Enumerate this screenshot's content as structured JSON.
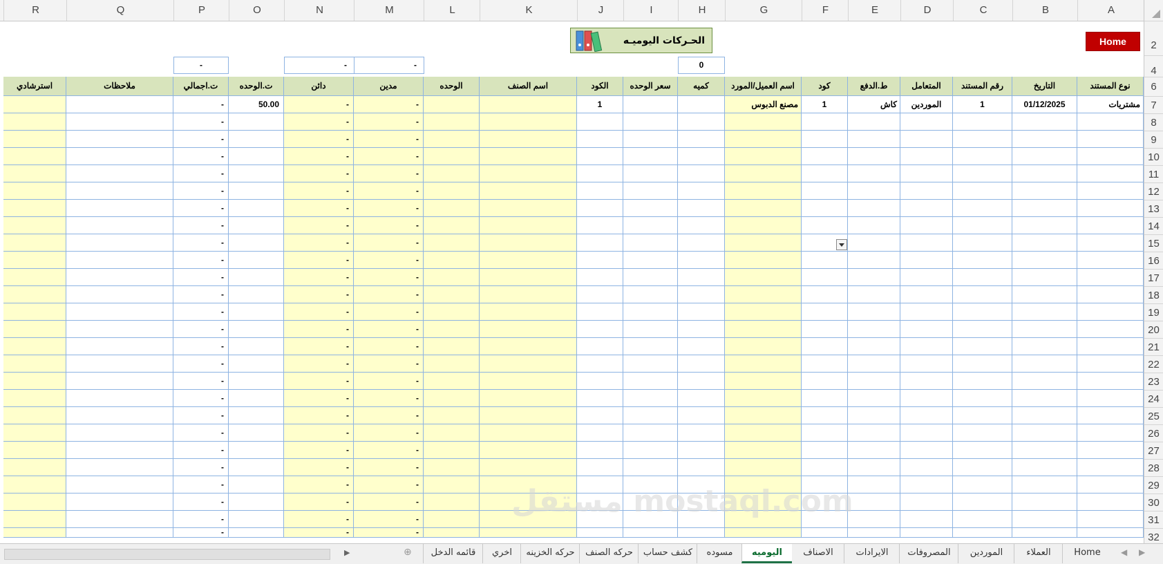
{
  "columns": [
    "R",
    "Q",
    "P",
    "O",
    "N",
    "M",
    "L",
    "K",
    "J",
    "I",
    "H",
    "G",
    "F",
    "E",
    "D",
    "C",
    "B",
    "A"
  ],
  "header_labels": [
    "استرشادي",
    "ملاحظات",
    "ت.اجمالي",
    "ت.الوحده",
    "دائن",
    "مدين",
    "الوحده",
    "اسم الصنف",
    "الكود",
    "سعر الوحده",
    "كميه",
    "اسم العميل/المورد",
    "كود",
    "ط.الدفع",
    "المتعامل",
    "رقم المستند",
    "التاريخ",
    "نوع المستند"
  ],
  "row_numbers": [
    "2",
    "4",
    "6",
    "7",
    "8",
    "9",
    "10",
    "11",
    "12",
    "13",
    "14",
    "15",
    "16",
    "17",
    "18",
    "19",
    "20",
    "21",
    "22",
    "23",
    "24",
    "25",
    "26",
    "27",
    "28",
    "29",
    "30",
    "31",
    "32"
  ],
  "home_button": "Home",
  "title": "الحـركات اليوميـه",
  "summary": {
    "p": "-",
    "n": "-",
    "m": "-",
    "h": "0"
  },
  "row7": {
    "doc_type": "مشتريات",
    "date": "01/12/2025",
    "doc_no": "1",
    "party": "الموردين",
    "pay": "كاش",
    "code": "1",
    "client": "مصنع الدبوس",
    "item_code": "1",
    "unit_price": "50.00",
    "total": "-",
    "debit": "-",
    "credit": "-"
  },
  "dash": "-",
  "tabs": [
    "Home",
    "العملاء",
    "الموردين",
    "المصروفات",
    "الايرادات",
    "الاصناف",
    "اليوميه",
    "مسوده",
    "كشف حساب",
    "حركه الصنف",
    "حركه الخزينه",
    "اخري",
    "قائمه الدخل"
  ],
  "active_tab": "اليوميه",
  "watermark": "مستقل mostaql.com"
}
